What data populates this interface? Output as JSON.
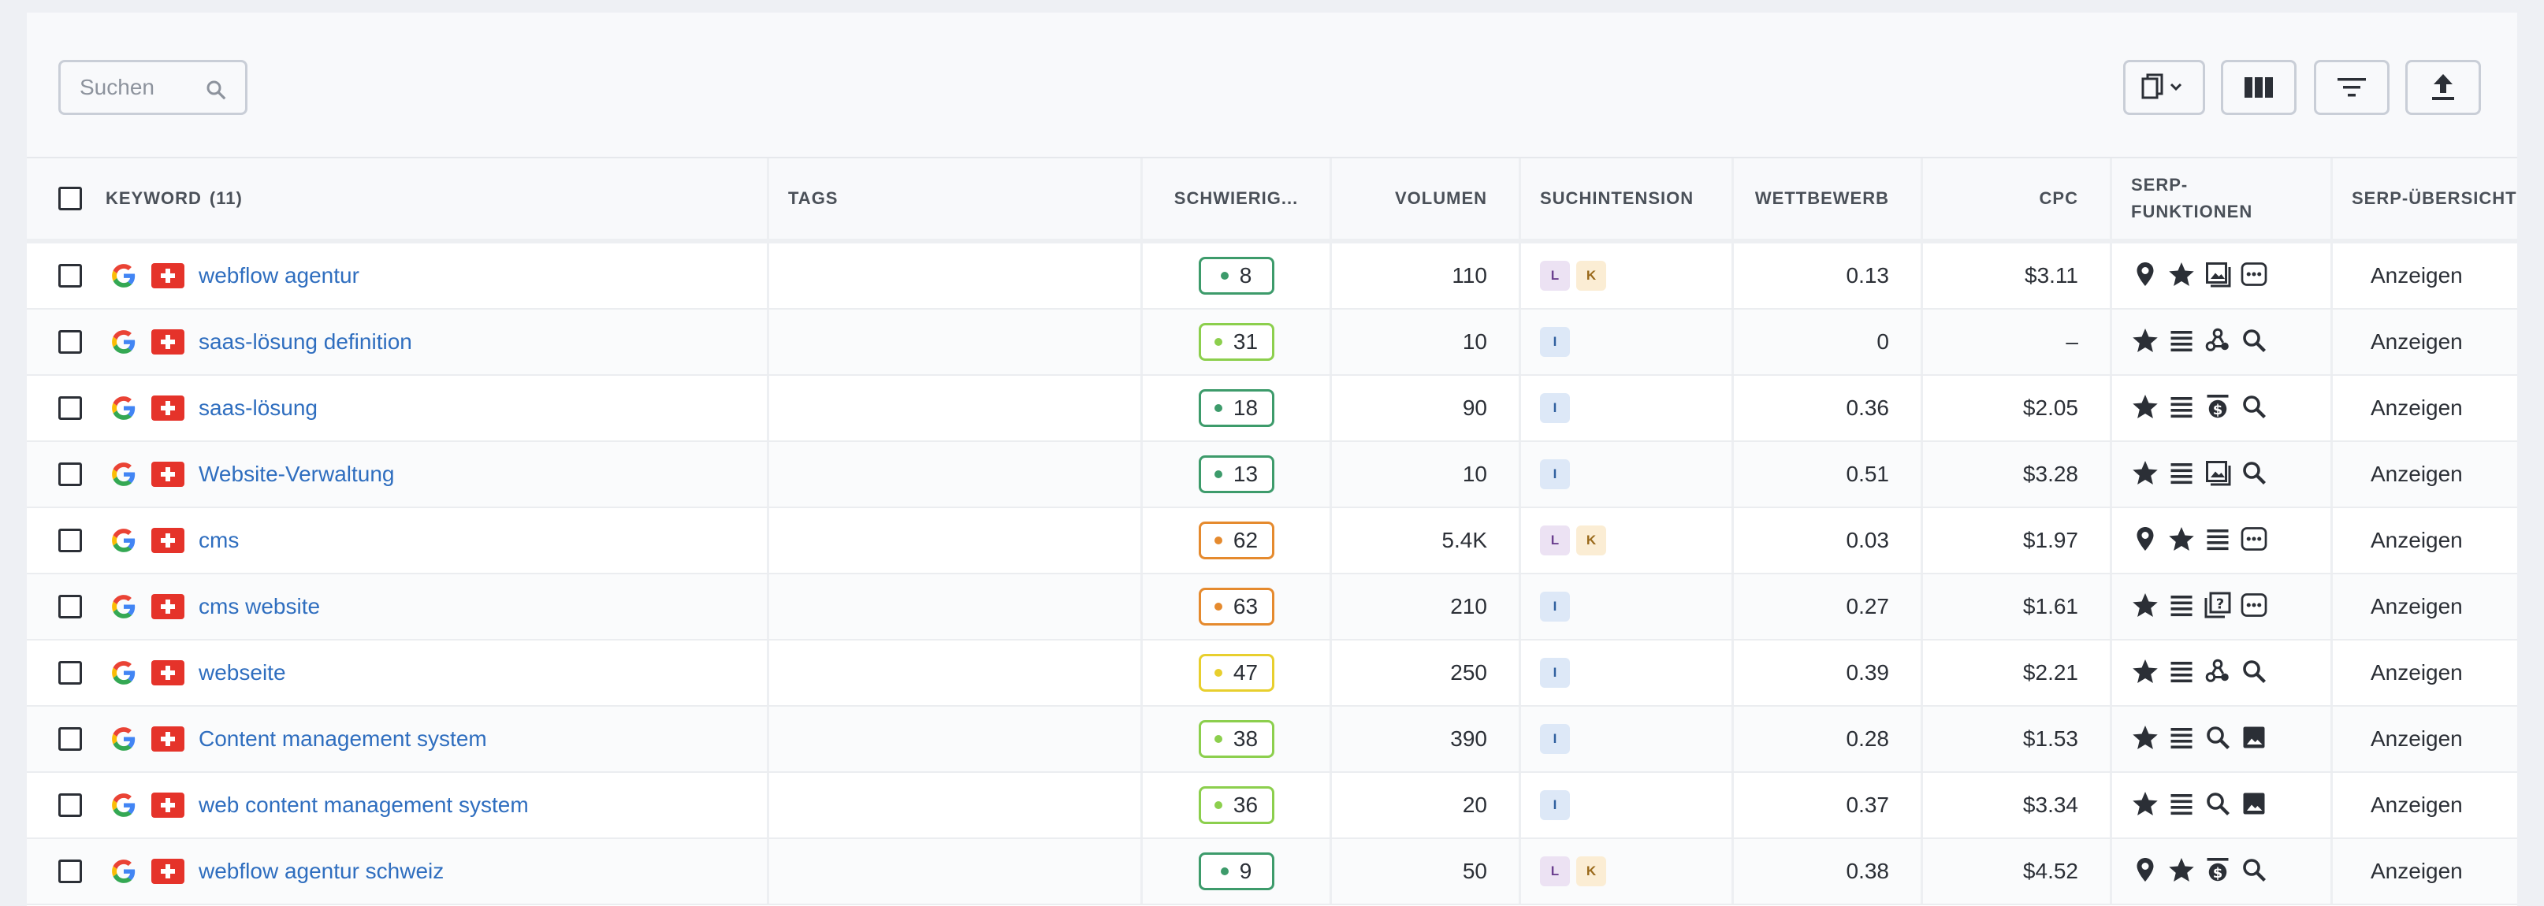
{
  "search": {
    "placeholder": "Suchen"
  },
  "toolbar": {
    "icons": [
      "copy-dropdown-icon",
      "columns-icon",
      "filter-icon",
      "export-icon"
    ]
  },
  "table": {
    "headers": {
      "keyword": "Keyword",
      "keyword_count": "(11)",
      "tags": "Tags",
      "difficulty": "Schwierig...",
      "volume": "Volumen",
      "intent": "Suchintension",
      "competition": "Wettbewerb",
      "cpc": "CPC",
      "serp_features_1": "SERP-",
      "serp_features_2": "Funktionen",
      "serp_overview": "SERP-Übersicht"
    },
    "show_label": "Anzeigen",
    "difficulty_colors": {
      "green": "#3d9b6b",
      "lightgreen": "#8ccf4d",
      "orange": "#e58a2e",
      "yellow": "#e8cf2e"
    },
    "intent_colors": {
      "L": {
        "bg": "#ece2f3",
        "fg": "#6b3f8f"
      },
      "K": {
        "bg": "#fbedd4",
        "fg": "#9a6a1c"
      },
      "I": {
        "bg": "#dde8f7",
        "fg": "#2f5f9e"
      }
    },
    "rows": [
      {
        "keyword": "webflow agentur",
        "difficulty": "8",
        "kd_color": "green",
        "volume": "110",
        "intent": [
          "L",
          "K"
        ],
        "competition": "0.13",
        "cpc": "$3.11",
        "serp": [
          "pin",
          "star",
          "image-box",
          "more"
        ]
      },
      {
        "keyword": "saas-lösung definition",
        "difficulty": "31",
        "kd_color": "lightgreen",
        "volume": "10",
        "intent": [
          "I"
        ],
        "competition": "0",
        "cpc": "–",
        "serp": [
          "star",
          "list",
          "nodes",
          "search"
        ]
      },
      {
        "keyword": "saas-lösung",
        "difficulty": "18",
        "kd_color": "green",
        "volume": "90",
        "intent": [
          "I"
        ],
        "competition": "0.36",
        "cpc": "$2.05",
        "serp": [
          "star",
          "list",
          "dollar-ad",
          "search"
        ]
      },
      {
        "keyword": "Website-Verwaltung",
        "difficulty": "13",
        "kd_color": "green",
        "volume": "10",
        "intent": [
          "I"
        ],
        "competition": "0.51",
        "cpc": "$3.28",
        "serp": [
          "star",
          "list",
          "image-box",
          "search"
        ]
      },
      {
        "keyword": "cms",
        "difficulty": "62",
        "kd_color": "orange",
        "volume": "5.4K",
        "intent": [
          "L",
          "K"
        ],
        "competition": "0.03",
        "cpc": "$1.97",
        "serp": [
          "pin",
          "star",
          "list",
          "more"
        ]
      },
      {
        "keyword": "cms website",
        "difficulty": "63",
        "kd_color": "orange",
        "volume": "210",
        "intent": [
          "I"
        ],
        "competition": "0.27",
        "cpc": "$1.61",
        "serp": [
          "star",
          "list",
          "question",
          "more"
        ]
      },
      {
        "keyword": "webseite",
        "difficulty": "47",
        "kd_color": "yellow",
        "volume": "250",
        "intent": [
          "I"
        ],
        "competition": "0.39",
        "cpc": "$2.21",
        "serp": [
          "star",
          "list",
          "nodes",
          "search"
        ]
      },
      {
        "keyword": "Content management system",
        "difficulty": "38",
        "kd_color": "lightgreen",
        "volume": "390",
        "intent": [
          "I"
        ],
        "competition": "0.28",
        "cpc": "$1.53",
        "serp": [
          "star",
          "list",
          "search",
          "image"
        ]
      },
      {
        "keyword": "web content management system",
        "difficulty": "36",
        "kd_color": "lightgreen",
        "volume": "20",
        "intent": [
          "I"
        ],
        "competition": "0.37",
        "cpc": "$3.34",
        "serp": [
          "star",
          "list",
          "search",
          "image"
        ]
      },
      {
        "keyword": "webflow agentur schweiz",
        "difficulty": "9",
        "kd_color": "green",
        "volume": "50",
        "intent": [
          "L",
          "K"
        ],
        "competition": "0.38",
        "cpc": "$4.52",
        "serp": [
          "pin",
          "star",
          "dollar-ad",
          "search"
        ]
      }
    ]
  }
}
